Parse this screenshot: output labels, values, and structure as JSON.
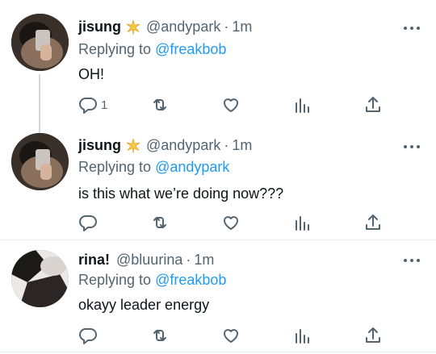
{
  "tweets": [
    {
      "name": "jisung",
      "badge_icon": "sparkle-star-icon",
      "handle": "@andypark",
      "separator": "·",
      "time": "1m",
      "reply_prefix": "Replying to",
      "reply_to": "@freakbob",
      "text": "OH!",
      "reply_count": "1"
    },
    {
      "name": "jisung",
      "badge_icon": "sparkle-star-icon",
      "handle": "@andypark",
      "separator": "·",
      "time": "1m",
      "reply_prefix": "Replying to",
      "reply_to": "@andypark",
      "text": "is this what we’re doing now???",
      "reply_count": ""
    },
    {
      "name": "rina!",
      "handle": "@bluurina",
      "separator": "·",
      "time": "1m",
      "reply_prefix": "Replying to",
      "reply_to": "@freakbob",
      "text": "okayy leader energy",
      "reply_count": ""
    }
  ],
  "colors": {
    "text": "#0f1419",
    "secondary": "#536471",
    "link": "#1d9bf0",
    "divider": "#e6ecf0",
    "badge": "#f5c945"
  }
}
